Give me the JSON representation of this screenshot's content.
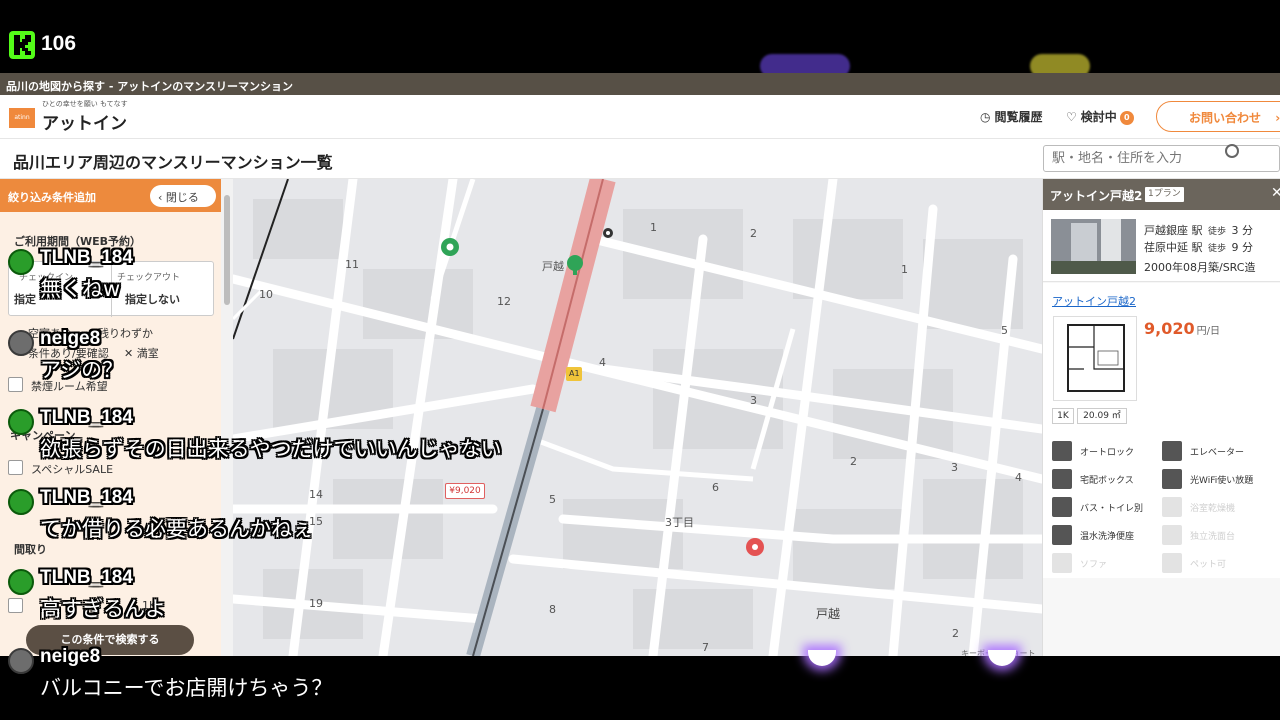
{
  "stream": {
    "viewer_count": "106"
  },
  "window": {
    "title": "品川の地図から探す - アットインのマンスリーマンション"
  },
  "header": {
    "brand_tagline": "ひとの幸せを願い もてなす",
    "brand_mark": "atinn",
    "brand_name": "アットイン",
    "history_label": "閲覧履歴",
    "favorites_label": "検討中",
    "favorites_count": "0",
    "contact_label": "お問い合わせ"
  },
  "page": {
    "title": "品川エリア周辺のマンスリーマンション一覧",
    "search_placeholder": "駅・地名・住所を入力"
  },
  "filter": {
    "title": "絞り込み条件追加",
    "close_label": "閉じる",
    "period_heading": "ご利用期間（WEB予約）",
    "checkin_label": "チェックイン",
    "checkout_label": "チェックアウト",
    "checkin_value": "指定",
    "checkout_value": "指定しない",
    "legend_vacant": "空室あり",
    "legend_few": "残りわずか",
    "legend_confirm": "条件あり/要確認",
    "legend_full": "満室",
    "nonsmoking": "禁煙ルーム希望",
    "campaign_heading": "キャンペーン",
    "special_sale": "スペシャルSALE",
    "layout_heading": "間取り",
    "layout_1k": "1K",
    "search_button": "この条件で検索する"
  },
  "map": {
    "labels": [
      "11",
      "10",
      "12",
      "1",
      "2",
      "1",
      "5",
      "4",
      "3",
      "2",
      "3",
      "4",
      "6",
      "5",
      "3丁目",
      "14",
      "15",
      "19",
      "8",
      "7",
      "2"
    ],
    "station_label": "戸越",
    "exit_label": "A1",
    "price_pin": "¥9,020",
    "area_label": "戸越",
    "attribution": "キーボード ショート"
  },
  "property": {
    "header_title": "アットイン戸越2",
    "plan_badge": "1プラン",
    "station1": "戸越銀座 駅",
    "walk1": "徒歩",
    "min1": "3 分",
    "station2": "荏原中延 駅",
    "walk2": "徒歩",
    "min2": "9 分",
    "built": "2000年08月築/SRC造",
    "link_name": "アットイン戸越2",
    "price": "9,020",
    "price_unit": "円/日",
    "layout": "1K",
    "area": "20.09 ㎡",
    "amenities": [
      {
        "label": "オートロック",
        "on": true
      },
      {
        "label": "エレベーター",
        "on": true
      },
      {
        "label": "宅配ボックス",
        "on": true
      },
      {
        "label": "光WiFi使い放題",
        "on": true
      },
      {
        "label": "バス・トイレ別",
        "on": true
      },
      {
        "label": "浴室乾燥機",
        "on": false
      },
      {
        "label": "温水洗浄便座",
        "on": true
      },
      {
        "label": "独立洗面台",
        "on": false
      },
      {
        "label": "ソファ",
        "on": false
      },
      {
        "label": "ペット可",
        "on": false
      }
    ]
  },
  "chat": [
    {
      "user": "TLNB_184",
      "message": "無くねw",
      "avatar": "green"
    },
    {
      "user": "neige8",
      "message": "アジの？",
      "avatar": "gray"
    },
    {
      "user": "TLNB_184",
      "message": "欲張らずその日出来るやつだけでいいんじゃない",
      "avatar": "green"
    },
    {
      "user": "TLNB_184",
      "message": "てか借りる必要あるんかねぇ",
      "avatar": "green"
    },
    {
      "user": "TLNB_184",
      "message": "高すぎるんよ",
      "avatar": "green"
    },
    {
      "user": "neige8",
      "message": "バルコニーでお店開けちゃう？",
      "avatar": "gray"
    }
  ]
}
